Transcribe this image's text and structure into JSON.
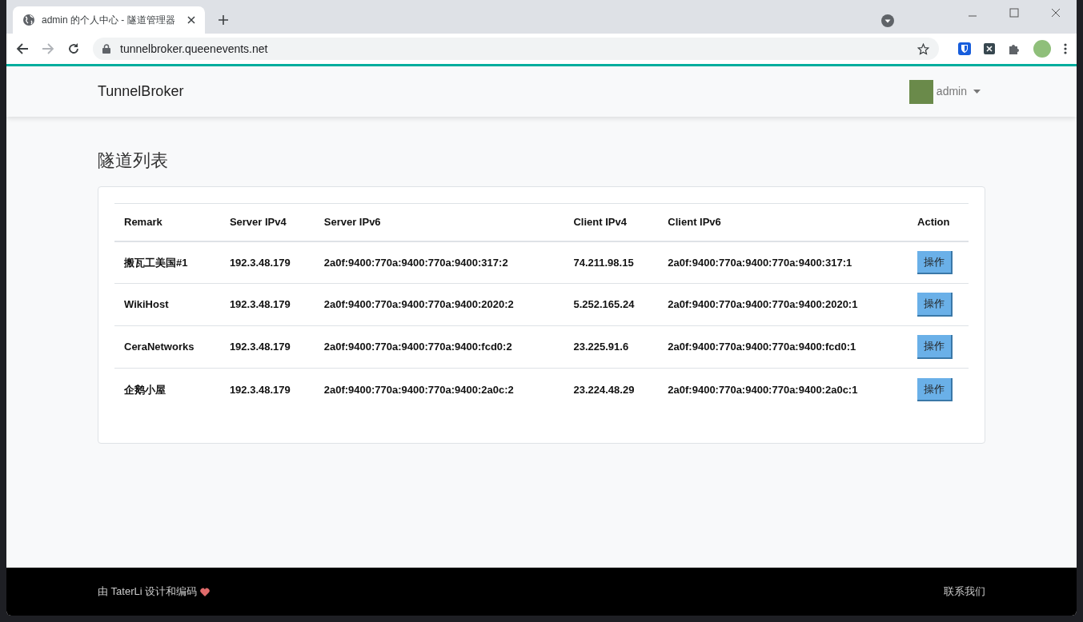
{
  "browser": {
    "tab_title": "admin 的个人中心 - 隧道管理器",
    "url": "tunnelbroker.queenevents.net"
  },
  "navbar": {
    "brand": "TunnelBroker",
    "user": "admin"
  },
  "page": {
    "title": "隧道列表"
  },
  "table": {
    "columns": [
      "Remark",
      "Server IPv4",
      "Server IPv6",
      "Client IPv4",
      "Client IPv6",
      "Action"
    ],
    "rows": [
      {
        "cells": [
          "搬瓦工美国#1",
          "192.3.48.179",
          "2a0f:9400:770a:9400:770a:9400:317:2",
          "74.211.98.15",
          "2a0f:9400:770a:9400:770a:9400:317:1"
        ],
        "action": "操作"
      },
      {
        "cells": [
          "WikiHost",
          "192.3.48.179",
          "2a0f:9400:770a:9400:770a:9400:2020:2",
          "5.252.165.24",
          "2a0f:9400:770a:9400:770a:9400:2020:1"
        ],
        "action": "操作"
      },
      {
        "cells": [
          "CeraNetworks",
          "192.3.48.179",
          "2a0f:9400:770a:9400:770a:9400:fcd0:2",
          "23.225.91.6",
          "2a0f:9400:770a:9400:770a:9400:fcd0:1"
        ],
        "action": "操作"
      },
      {
        "cells": [
          "企鹅小屋",
          "192.3.48.179",
          "2a0f:9400:770a:9400:770a:9400:2a0c:2",
          "23.224.48.29",
          "2a0f:9400:770a:9400:770a:9400:2a0c:1"
        ],
        "action": "操作"
      }
    ]
  },
  "footer": {
    "credit": "由 TaterLi 设计和编码",
    "contact": "联系我们"
  }
}
